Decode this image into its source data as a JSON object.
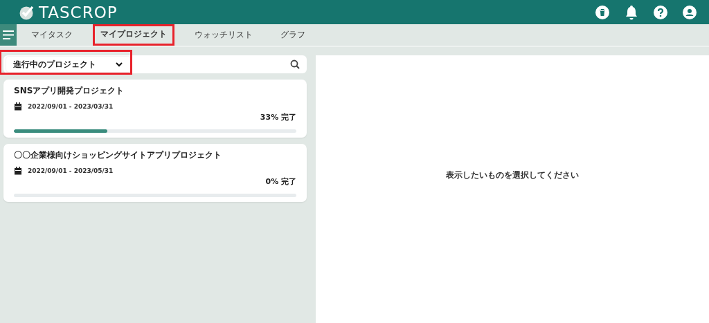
{
  "header": {
    "logo": "TASCROP"
  },
  "tabs": [
    {
      "label": "マイタスク",
      "selected": false,
      "highlighted": false
    },
    {
      "label": "マイプロジェクト",
      "selected": true,
      "highlighted": true
    },
    {
      "label": "ウォッチリスト",
      "selected": false,
      "highlighted": false
    },
    {
      "label": "グラフ",
      "selected": false,
      "highlighted": false
    }
  ],
  "filter": {
    "value": "進行中のプロジェクト",
    "highlighted": true
  },
  "projects": [
    {
      "name": "SNSアプリ開発プロジェクト",
      "period": "2022/09/01 - 2023/03/31",
      "progress": "33% 完了",
      "level": 0.33
    },
    {
      "name": "〇〇企業様向けショッピングサイトアプリプロジェクト",
      "period": "2022/09/01 - 2023/05/31",
      "progress": "0% 完了",
      "level": 0
    }
  ],
  "detail": {
    "message": "表示したいものを選択してください"
  }
}
